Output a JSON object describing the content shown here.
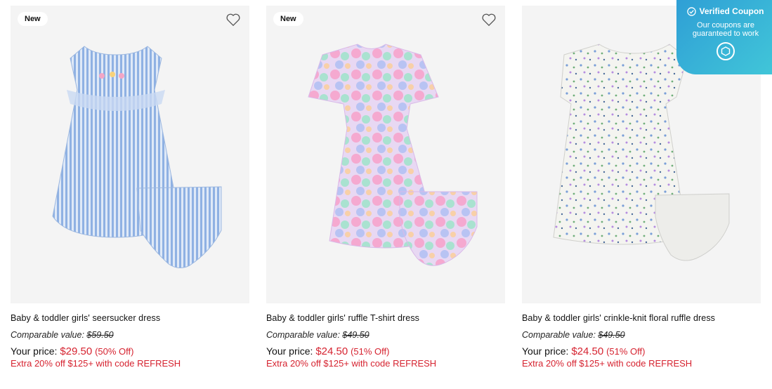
{
  "products": [
    {
      "badge": "New",
      "name": "Baby & toddler girls' seersucker dress",
      "comparable_label": "Comparable value:",
      "comparable_price": "$59.50",
      "your_price_label": "Your price:",
      "sale_price": "$29.50",
      "discount": "(50% Off)",
      "promo": "Extra 20% off $125+ with code REFRESH"
    },
    {
      "badge": "New",
      "name": "Baby & toddler girls' ruffle T-shirt dress",
      "comparable_label": "Comparable value:",
      "comparable_price": "$49.50",
      "your_price_label": "Your price:",
      "sale_price": "$24.50",
      "discount": "(51% Off)",
      "promo": "Extra 20% off $125+ with code REFRESH"
    },
    {
      "badge": "",
      "name": "Baby & toddler girls' crinkle-knit floral ruffle dress",
      "comparable_label": "Comparable value:",
      "comparable_price": "$49.50",
      "your_price_label": "Your price:",
      "sale_price": "$24.50",
      "discount": "(51% Off)",
      "promo": "Extra 20% off $125+ with code REFRESH"
    }
  ],
  "coupon": {
    "title": "Verified Coupon",
    "subtitle_line1": "Our coupons are",
    "subtitle_line2": "guaranteed to work"
  },
  "colors": {
    "sale": "#d62330",
    "coupon_gradient_start": "#2f9fd6",
    "coupon_gradient_end": "#41c6d8",
    "image_bg": "#f4f4f4"
  },
  "icons": {
    "wishlist": "heart-outline-icon",
    "coupon_check": "check-circle-icon",
    "coupon_logo": "hexagon-logo-icon"
  }
}
